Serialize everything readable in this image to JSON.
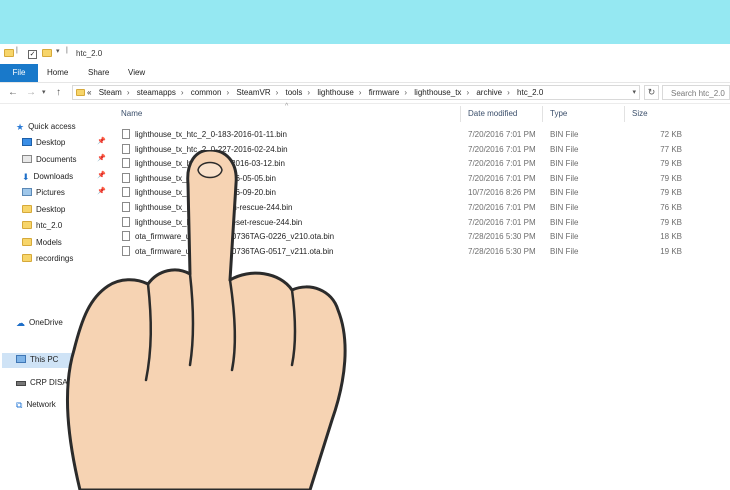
{
  "window": {
    "title": "htc_2.0"
  },
  "ribbon": {
    "tabs": [
      "File",
      "Home",
      "Share",
      "View"
    ]
  },
  "address": {
    "breadcrumb_prefix": "«",
    "crumbs": [
      "Steam",
      "steamapps",
      "common",
      "SteamVR",
      "tools",
      "lighthouse",
      "firmware",
      "lighthouse_tx",
      "archive",
      "htc_2.0"
    ],
    "search_placeholder": "Search htc_2.0"
  },
  "nav": {
    "items": [
      {
        "label": "Quick access",
        "icon": "star-icon",
        "pinned": false
      },
      {
        "label": "Desktop",
        "icon": "desktop-icon",
        "pinned": true
      },
      {
        "label": "Documents",
        "icon": "documents-icon",
        "pinned": true
      },
      {
        "label": "Downloads",
        "icon": "downloads-icon",
        "pinned": true
      },
      {
        "label": "Pictures",
        "icon": "pictures-icon",
        "pinned": true
      },
      {
        "label": "Desktop",
        "icon": "folder-icon",
        "pinned": false
      },
      {
        "label": "htc_2.0",
        "icon": "folder-icon",
        "pinned": false
      },
      {
        "label": "Models",
        "icon": "folder-icon",
        "pinned": false
      },
      {
        "label": "recordings",
        "icon": "folder-icon",
        "pinned": false
      },
      {
        "label": "OneDrive",
        "icon": "cloud-icon",
        "pinned": false
      },
      {
        "label": "This PC",
        "icon": "computer-icon",
        "pinned": false
      },
      {
        "label": "CRP DISABLD (E:)",
        "icon": "drive-icon",
        "pinned": false
      },
      {
        "label": "Network",
        "icon": "network-icon",
        "pinned": false
      }
    ],
    "selected": "This PC"
  },
  "columns": {
    "name": "Name",
    "date": "Date modified",
    "type": "Type",
    "size": "Size"
  },
  "files": [
    {
      "name": "lighthouse_tx_htc_2_0-183-2016-01-11.bin",
      "date": "7/20/2016 7:01 PM",
      "type": "BIN File",
      "size": "72 KB"
    },
    {
      "name": "lighthouse_tx_htc_2_0-227-2016-02-24.bin",
      "date": "7/20/2016 7:01 PM",
      "type": "BIN File",
      "size": "77 KB"
    },
    {
      "name": "lighthouse_tx_htc_2_0-2    2016-03-12.bin",
      "date": "7/20/2016 7:01 PM",
      "type": "BIN File",
      "size": "79 KB"
    },
    {
      "name": "lighthouse_tx_htc_2_0-    016-05-05.bin",
      "date": "7/20/2016 7:01 PM",
      "type": "BIN File",
      "size": "79 KB"
    },
    {
      "name": "lighthouse_tx_htc_2_0-    016-09-20.bin",
      "date": "10/7/2016 8:26 PM",
      "type": "BIN File",
      "size": "79 KB"
    },
    {
      "name": "lighthouse_tx_htc_2_0     ion-rescue-244.bin",
      "date": "7/20/2016 7:01 PM",
      "type": "BIN File",
      "size": "76 KB"
    },
    {
      "name": "lighthouse_tx_htc_2_0     -reset-rescue-244.bin",
      "date": "7/20/2016 7:01 PM",
      "type": "BIN File",
      "size": "79 KB"
    },
    {
      "name": "ota_firmware_upgra    CM20736TAG-0226_v210.ota.bin",
      "date": "7/28/2016 5:30 PM",
      "type": "BIN File",
      "size": "18 KB"
    },
    {
      "name": "ota_firmware_upgra    CM20736TAG-0517_v211.ota.bin",
      "date": "7/28/2016 5:30 PM",
      "type": "BIN File",
      "size": "19 KB"
    }
  ],
  "colors": {
    "accent": "#1979ca",
    "background": "#95e8f2",
    "selection": "#cfe3f6"
  }
}
